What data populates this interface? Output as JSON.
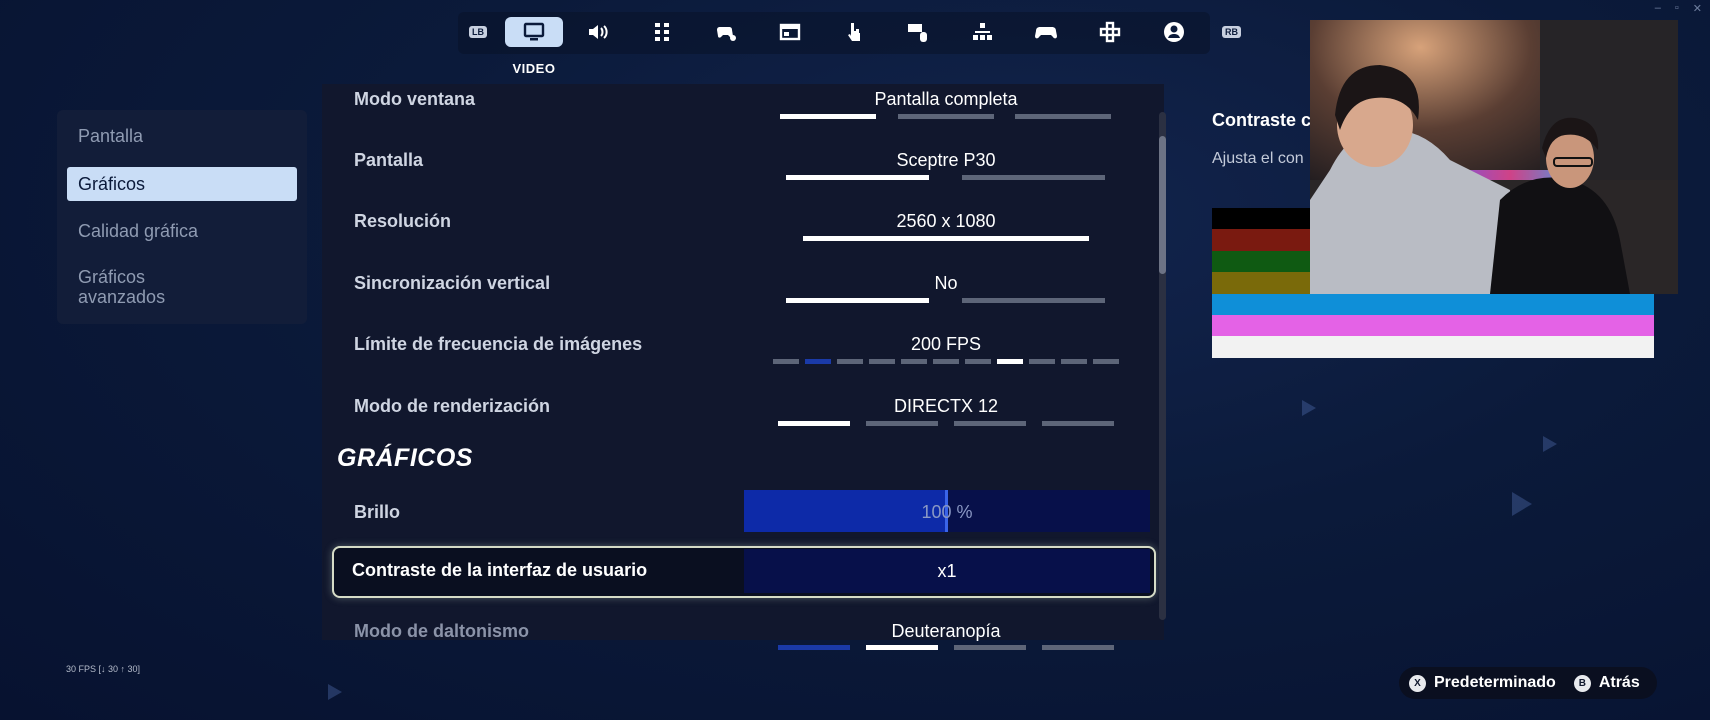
{
  "window_controls": [
    "–",
    "▫",
    "✕"
  ],
  "nav": {
    "left_bumper": "LB",
    "right_bumper": "RB",
    "active_caption": "VIDEO",
    "tabs": [
      {
        "icon": "monitor-icon",
        "active": true
      },
      {
        "icon": "speaker-icon"
      },
      {
        "icon": "grid-icon"
      },
      {
        "icon": "gamepad-touch-icon"
      },
      {
        "icon": "window-icon"
      },
      {
        "icon": "touch-hand-icon"
      },
      {
        "icon": "keyboard-mouse-icon"
      },
      {
        "icon": "hierarchy-icon"
      },
      {
        "icon": "controller-icon"
      },
      {
        "icon": "dpad-icon"
      },
      {
        "icon": "user-icon"
      }
    ]
  },
  "sidebar": {
    "items": [
      {
        "label": "Pantalla"
      },
      {
        "label": "Gráficos",
        "active": true
      },
      {
        "label": "Calidad gráfica"
      },
      {
        "label": "Gráficos avanzados"
      }
    ]
  },
  "settings": {
    "window_mode": {
      "label": "Modo ventana",
      "value": "Pantalla completa",
      "options": 3,
      "selected": 0
    },
    "display": {
      "label": "Pantalla",
      "value": "Sceptre P30",
      "options": 2,
      "selected": 0
    },
    "resolution": {
      "label": "Resolución",
      "value": "2560 x 1080",
      "options": 1,
      "selected": 0
    },
    "vsync": {
      "label": "Sincronización vertical",
      "value": "No",
      "options": 2,
      "selected": 0
    },
    "frame_limit": {
      "label": "Límite de frecuencia de imágenes",
      "value": "200 FPS",
      "options": 11,
      "selected": 7,
      "highlighted": 1
    },
    "render_mode": {
      "label": "Modo de renderización",
      "value": "DIRECTX 12",
      "options": 4,
      "selected": 0
    },
    "section_title": "GRÁFICOS",
    "brightness": {
      "label": "Brillo",
      "value": "100 %",
      "fill_fraction": 0.5
    },
    "ui_contrast": {
      "label": "Contraste de la interfaz de usuario",
      "value": "x1"
    },
    "colorblind": {
      "label": "Modo de daltonismo",
      "value": "Deuteranopía",
      "options": 4,
      "selected": 1,
      "highlighted": 0
    }
  },
  "info": {
    "title": "Contraste c",
    "description": "Ajusta el con"
  },
  "swatch_colors": [
    "#000000",
    "#7a1a10",
    "#0f5a12",
    "#7a6a0a",
    "#0f8fd8",
    "#e462e6",
    "#f2f2f2"
  ],
  "fps_counter": "30 FPS [↓ 30 ↑ 30]",
  "footer": {
    "default_key": "X",
    "default_label": "Predeterminado",
    "back_key": "B",
    "back_label": "Atrás"
  },
  "colors": {
    "accent": "#c9ddf6",
    "bar_fill": "#0d2aa8",
    "bar_bg": "#07104a"
  }
}
